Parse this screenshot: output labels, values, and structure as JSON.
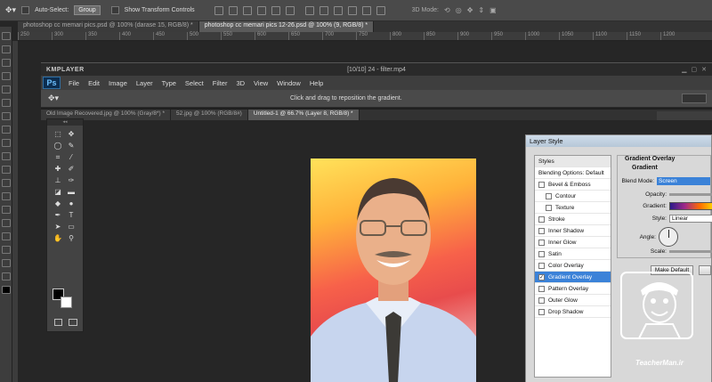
{
  "outer_options": {
    "auto_select_label": "Auto-Select:",
    "auto_select_value": "Group",
    "show_transform_label": "Show Transform Controls",
    "mode_3d_label": "3D Mode:"
  },
  "outer_tabs": [
    {
      "label": "photoshop cc memari pics.psd @ 100% (darase 15, RGB/8) *"
    },
    {
      "label": "photoshop cc memari pics 12-26.psd @ 100% (9, RGB/8) *"
    }
  ],
  "ruler_ticks": [
    "250",
    "300",
    "350",
    "400",
    "450",
    "500",
    "550",
    "600",
    "650",
    "700",
    "750",
    "800",
    "850",
    "900",
    "950",
    "1000",
    "1050",
    "1100",
    "1150",
    "1200"
  ],
  "player": {
    "logo": "KMPLAYER",
    "file_title": "[10/10] 24 - filter.mp4"
  },
  "ps": {
    "logo": "Ps",
    "menu": [
      "File",
      "Edit",
      "Image",
      "Layer",
      "Type",
      "Select",
      "Filter",
      "3D",
      "View",
      "Window",
      "Help"
    ],
    "hint": "Click and drag to reposition the gradient.",
    "doc_tabs": [
      {
        "label": "Old Image Recovered.jpg @ 100% (Gray/8*) *"
      },
      {
        "label": "52.jpg @ 100% (RGB/8#)"
      },
      {
        "label": "Untitled-1 @ 66.7% (Layer 8, RGB/8) *"
      }
    ]
  },
  "layer_style": {
    "title": "Layer Style",
    "styles_header": "Styles",
    "blending_options": "Blending Options: Default",
    "items": [
      {
        "label": "Bevel & Emboss",
        "checked": false,
        "indent": false,
        "selected": false
      },
      {
        "label": "Contour",
        "checked": false,
        "indent": true,
        "selected": false
      },
      {
        "label": "Texture",
        "checked": false,
        "indent": true,
        "selected": false
      },
      {
        "label": "Stroke",
        "checked": false,
        "indent": false,
        "selected": false
      },
      {
        "label": "Inner Shadow",
        "checked": false,
        "indent": false,
        "selected": false
      },
      {
        "label": "Inner Glow",
        "checked": false,
        "indent": false,
        "selected": false
      },
      {
        "label": "Satin",
        "checked": false,
        "indent": false,
        "selected": false
      },
      {
        "label": "Color Overlay",
        "checked": false,
        "indent": false,
        "selected": false
      },
      {
        "label": "Gradient Overlay",
        "checked": true,
        "indent": false,
        "selected": true
      },
      {
        "label": "Pattern Overlay",
        "checked": false,
        "indent": false,
        "selected": false
      },
      {
        "label": "Outer Glow",
        "checked": false,
        "indent": false,
        "selected": false
      },
      {
        "label": "Drop Shadow",
        "checked": false,
        "indent": false,
        "selected": false
      }
    ],
    "group_title": "Gradient Overlay",
    "group_sub": "Gradient",
    "blend_mode_label": "Blend Mode:",
    "blend_mode_value": "Screen",
    "opacity_label": "Opacity:",
    "gradient_label": "Gradient:",
    "style_label": "Style:",
    "style_value": "Linear",
    "angle_label": "Angle:",
    "scale_label": "Scale:",
    "make_default": "Make Default"
  },
  "watermark": {
    "text": "TeacherMan.ir"
  },
  "colors": {
    "selected": "#3b82d8",
    "ps_logo_bg": "#0c2d4f",
    "ps_logo_fg": "#6ec1ff"
  }
}
